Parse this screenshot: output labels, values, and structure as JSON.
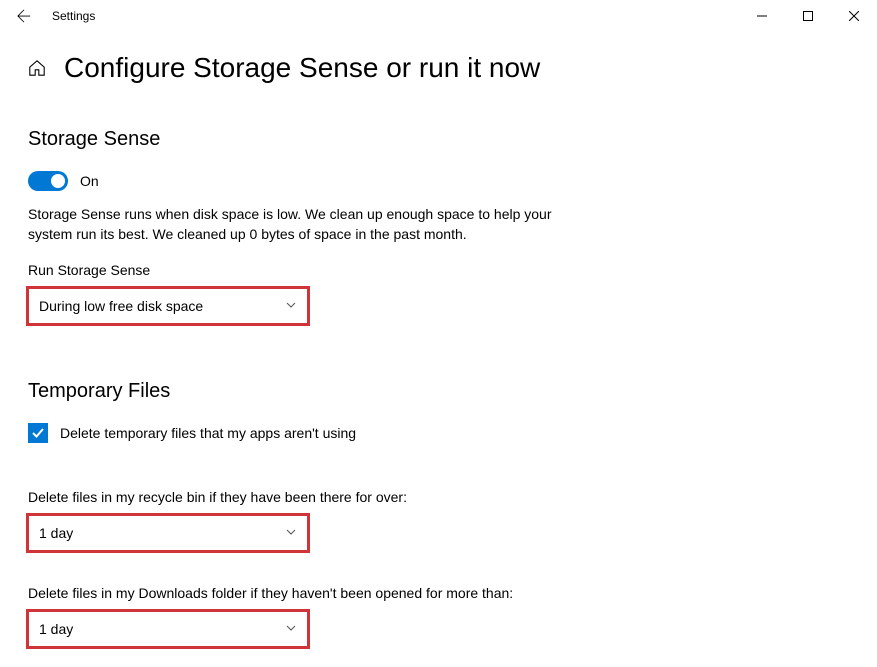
{
  "titlebar": {
    "title": "Settings"
  },
  "page": {
    "title": "Configure Storage Sense or run it now"
  },
  "storageSense": {
    "sectionTitle": "Storage Sense",
    "toggleLabel": "On",
    "toggleState": true,
    "description": "Storage Sense runs when disk space is low. We clean up enough space to help your system run its best. We cleaned up 0 bytes of space in the past month.",
    "runLabel": "Run Storage Sense",
    "runValue": "During low free disk space"
  },
  "temporaryFiles": {
    "sectionTitle": "Temporary Files",
    "checkboxLabel": "Delete temporary files that my apps aren't using",
    "checkboxChecked": true,
    "recycleBinLabel": "Delete files in my recycle bin if they have been there for over:",
    "recycleBinValue": "1 day",
    "downloadsLabel": "Delete files in my Downloads folder if they haven't been opened for more than:",
    "downloadsValue": "1 day"
  }
}
